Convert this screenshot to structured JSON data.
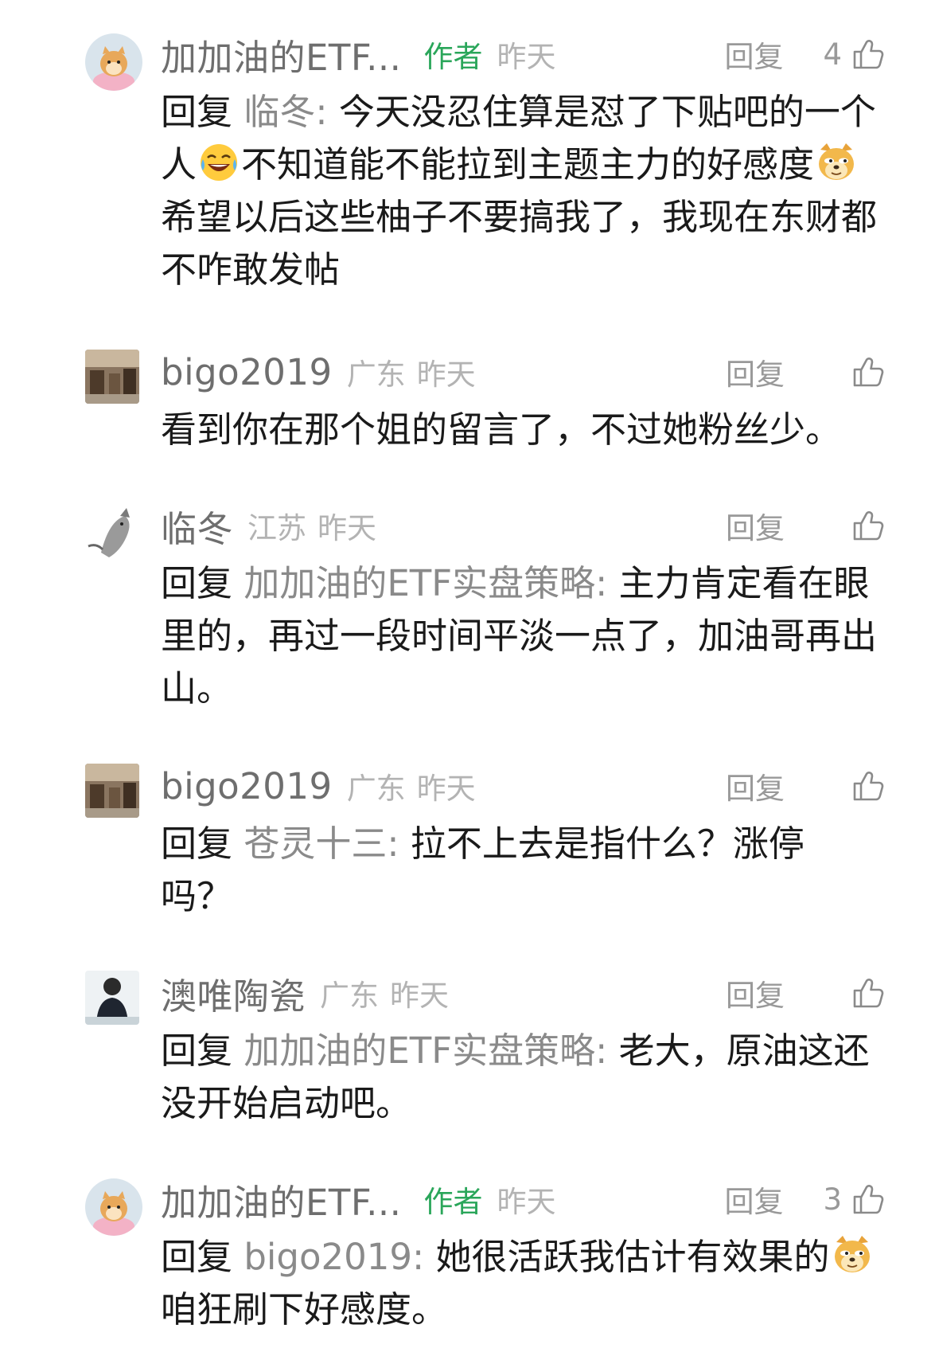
{
  "comments": [
    {
      "username": "加加油的ETF...",
      "is_author": true,
      "author_tag": "作者",
      "location": "",
      "time": "昨天",
      "reply_label": "回复",
      "likes": "4",
      "text": {
        "reply_prefix": "回复",
        "reply_target": "临冬:",
        "part1": "今天没忍住算是怼了下贴吧的一个人",
        "emoji1": "laugh-cry-emoji",
        "part2": "不知道能不能拉到主题主力的好感度",
        "emoji2": "doge-emoji",
        "part3": "希望以后这些柚子不要搞我了，我现在东财都不咋敢发帖"
      }
    },
    {
      "username": "bigo2019",
      "location": "广东",
      "time": "昨天",
      "reply_label": "回复",
      "likes": "",
      "text": {
        "part1": "看到你在那个姐的留言了，不过她粉丝少。"
      }
    },
    {
      "username": "临冬",
      "location": "江苏",
      "time": "昨天",
      "reply_label": "回复",
      "likes": "",
      "text": {
        "reply_prefix": "回复",
        "reply_target": "加加油的ETF实盘策略:",
        "part1": "主力肯定看在眼里的，再过一段时间平淡一点了，加油哥再出山。"
      }
    },
    {
      "username": "bigo2019",
      "location": "广东",
      "time": "昨天",
      "reply_label": "回复",
      "likes": "",
      "text": {
        "reply_prefix": "回复",
        "reply_target": "苍灵十三:",
        "part1": "拉不上去是指什么？涨停吗？"
      }
    },
    {
      "username": "澳唯陶瓷",
      "location": "广东",
      "time": "昨天",
      "reply_label": "回复",
      "likes": "",
      "text": {
        "reply_prefix": "回复",
        "reply_target": "加加油的ETF实盘策略:",
        "part1": "老大，原油这还没开始启动吧。"
      }
    },
    {
      "username": "加加油的ETF...",
      "is_author": true,
      "author_tag": "作者",
      "location": "",
      "time": "昨天",
      "reply_label": "回复",
      "likes": "3",
      "text": {
        "reply_prefix": "回复",
        "reply_target": "bigo2019:",
        "part1": "她很活跃我估计有效果的",
        "emoji1": "doge-emoji",
        "part2": "咱狂刷下好感度。"
      }
    }
  ],
  "colors": {
    "author_tag": "#2aa65a",
    "username": "#6e6e6e",
    "meta": "#b3b3b3",
    "reply_target": "#8a8a8a",
    "body": "#1a1a1a"
  }
}
